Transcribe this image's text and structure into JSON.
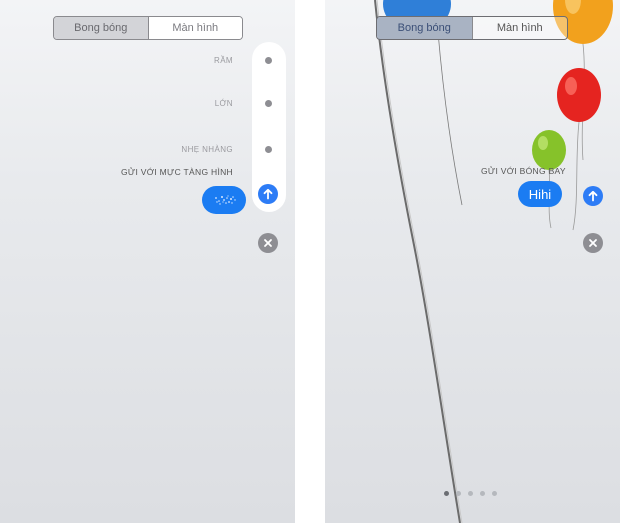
{
  "left_screen": {
    "tabs": [
      {
        "label": "Bong bóng",
        "active": true
      },
      {
        "label": "Màn hình",
        "active": false
      }
    ],
    "effects": [
      "RẦM",
      "LỚN",
      "NHẸ NHÀNG"
    ],
    "hint": "GỬI VỚI MỰC TÀNG HÌNH",
    "selected_effect": "invisible ink",
    "send_icon": "arrow-up-icon",
    "close_icon": "x-icon"
  },
  "right_screen": {
    "tabs": [
      {
        "label": "Bong bóng",
        "active": true
      },
      {
        "label": "Màn hình",
        "active": false
      }
    ],
    "hint": "GỬI VỚI BÓNG BAY",
    "message": "Hihi",
    "send_icon": "arrow-up-icon",
    "close_icon": "x-icon",
    "page_dots": 5,
    "active_page": 1,
    "balloon_colors": [
      "#2f7fd8",
      "#f2a11d",
      "#e52420",
      "#86c22a"
    ]
  },
  "colors": {
    "accent": "#1b7cf2",
    "close": "#8e8e93"
  }
}
